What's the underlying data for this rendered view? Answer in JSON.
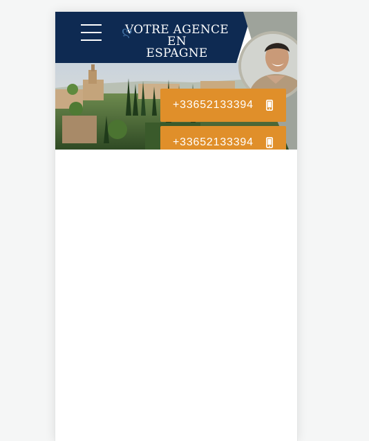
{
  "header": {
    "logo_line1": "VOTRE AGENCE",
    "logo_line2": "EN",
    "logo_line3": "ESPAGNE",
    "logo_mark": "swirl-logo-icon",
    "menu_icon": "hamburger-icon"
  },
  "contact": {
    "phone_primary": "+33652133394",
    "phone_secondary": "+33652133394",
    "phone_icon": "mobile-phone-icon"
  },
  "colors": {
    "navy": "#0e2a52",
    "accent": "#e08f2a",
    "page_bg": "#f5f6f6"
  }
}
